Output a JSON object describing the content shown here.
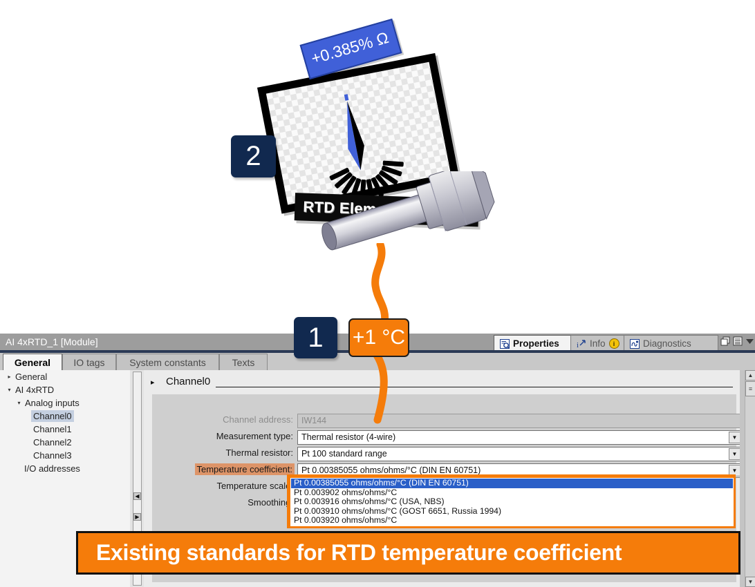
{
  "illustration": {
    "badge_two": "2",
    "badge_one": "1",
    "temp_badge": "+1 °C",
    "ohm_tag": "+0.385% Ω",
    "gauge_label": "RTD Element Resistance",
    "probe_name": "rtd-probe"
  },
  "window": {
    "title": "AI 4xRTD_1 [Module]",
    "controls": [
      "restore-icon",
      "list-icon",
      "chevron-down-icon"
    ]
  },
  "right_tabs": [
    {
      "label": "Properties",
      "icon": "properties-icon",
      "active": true
    },
    {
      "label": "Info",
      "icon": "info-icon",
      "badge": "i",
      "active": false
    },
    {
      "label": "Diagnostics",
      "icon": "diagnostics-icon",
      "active": false
    }
  ],
  "tabs": [
    {
      "label": "General",
      "active": true
    },
    {
      "label": "IO tags",
      "active": false
    },
    {
      "label": "System constants",
      "active": false
    },
    {
      "label": "Texts",
      "active": false
    }
  ],
  "tree": [
    {
      "label": "General",
      "indent": 0,
      "arrow": "collapsed",
      "selected": false
    },
    {
      "label": "AI 4xRTD",
      "indent": 0,
      "arrow": "expanded",
      "selected": false
    },
    {
      "label": "Analog inputs",
      "indent": 1,
      "arrow": "expanded",
      "selected": false
    },
    {
      "label": "Channel0",
      "indent": 2,
      "arrow": "none",
      "selected": true
    },
    {
      "label": "Channel1",
      "indent": 2,
      "arrow": "none",
      "selected": false
    },
    {
      "label": "Channel2",
      "indent": 2,
      "arrow": "none",
      "selected": false
    },
    {
      "label": "Channel3",
      "indent": 2,
      "arrow": "none",
      "selected": false
    },
    {
      "label": "I/O addresses",
      "indent": 1,
      "arrow": "none",
      "selected": false
    }
  ],
  "content": {
    "section_title": "Channel0",
    "fields": [
      {
        "label": "Channel address:",
        "value": "IW144",
        "type": "text",
        "disabled": true,
        "highlight": false
      },
      {
        "label": "Measurement type:",
        "value": "Thermal resistor (4-wire)",
        "type": "combo",
        "disabled": false,
        "highlight": false
      },
      {
        "label": "Thermal resistor:",
        "value": "Pt 100 standard range",
        "type": "combo",
        "disabled": false,
        "highlight": false
      },
      {
        "label": "Temperature coefficient:",
        "value": "Pt 0.00385055 ohms/ohms/°C (DIN EN 60751)",
        "type": "combo",
        "disabled": false,
        "highlight": true
      },
      {
        "label": "Temperature scale:",
        "value": "",
        "type": "none",
        "disabled": false,
        "highlight": false
      },
      {
        "label": "Smoothing:",
        "value": "",
        "type": "none",
        "disabled": false,
        "highlight": false
      }
    ]
  },
  "dropdown": {
    "options": [
      {
        "label": "Pt 0.00385055 ohms/ohms/°C (DIN EN 60751)",
        "selected": true
      },
      {
        "label": "Pt 0.003902 ohms/ohms/°C",
        "selected": false
      },
      {
        "label": "Pt 0.003916 ohms/ohms/°C (USA, NBS)",
        "selected": false
      },
      {
        "label": "Pt 0.003910 ohms/ohms/°C (GOST 6651, Russia 1994)",
        "selected": false
      },
      {
        "label": "Pt 0.003920 ohms/ohms/°C",
        "selected": false
      }
    ]
  },
  "banner": {
    "text": "Existing standards for RTD temperature coefficient"
  },
  "colors": {
    "accent_orange": "#f57c0a",
    "badge_navy": "#11294f",
    "select_blue": "#2a5fc8",
    "tag_blue": "#4060d8",
    "label_highlight": "#dd9468"
  }
}
